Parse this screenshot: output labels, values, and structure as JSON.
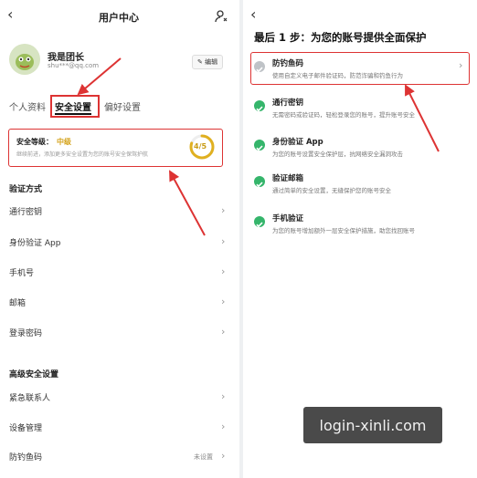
{
  "left": {
    "title": "用户中心",
    "user": {
      "name": "我是团长",
      "email": "shu***@qq.com",
      "edit_label": "编辑"
    },
    "tabs": [
      "个人资料",
      "安全设置",
      "偏好设置"
    ],
    "security": {
      "label": "安全等级：",
      "level": "中级",
      "desc": "继续前进，添加更多安全设置为您的账号安全保驾护航",
      "progress_text": "4/5",
      "progress_value": 0.8
    },
    "verify_section": {
      "title": "验证方式",
      "items": [
        "通行密钥",
        "身份验证 App",
        "手机号",
        "邮箱",
        "登录密码"
      ]
    },
    "advanced_section": {
      "title": "高级安全设置",
      "items": [
        {
          "label": "紧急联系人",
          "value": ""
        },
        {
          "label": "设备管理",
          "value": ""
        },
        {
          "label": "防钓鱼码",
          "value": "未设置"
        }
      ]
    }
  },
  "right": {
    "title": "最后 1 步：为您的账号提供全面保护",
    "items": [
      {
        "title": "防钓鱼码",
        "desc": "使用自定义电子邮件验证码，防范诈骗和钓鱼行为",
        "done": false
      },
      {
        "title": "通行密钥",
        "desc": "无需密码或验证码，轻松登录您的账号，提升账号安全",
        "done": true
      },
      {
        "title": "身份验证 App",
        "desc": "为您的账号设置安全保护层，抗网络安全漏洞攻击",
        "done": true
      },
      {
        "title": "验证邮箱",
        "desc": "通过简单的安全设置，无缝保护您的账号安全",
        "done": true
      },
      {
        "title": "手机验证",
        "desc": "为您的账号增加额外一层安全保护措施，助您找回账号",
        "done": true
      }
    ]
  },
  "watermark": "login-xinli.com",
  "colors": {
    "accent_red": "#d33333",
    "check_green": "#35b56b",
    "level_gold": "#d4a21a"
  }
}
